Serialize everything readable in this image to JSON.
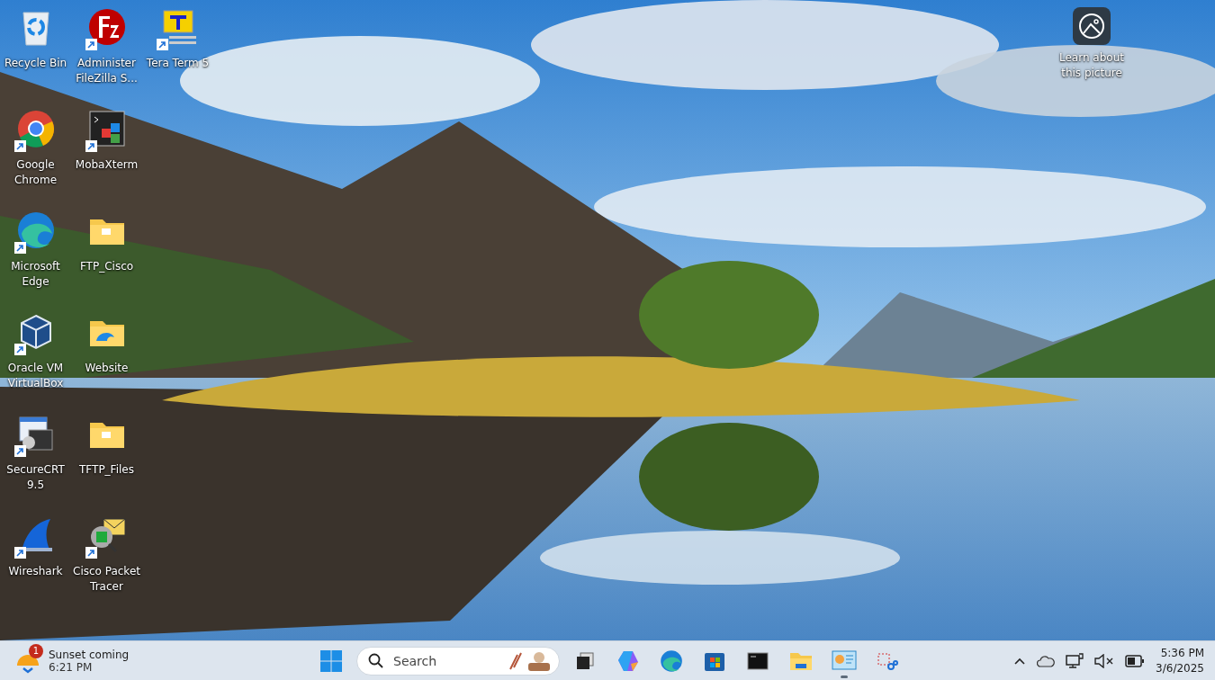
{
  "desktop_icons": [
    {
      "label": "Recycle Bin",
      "kind": "recycle-bin",
      "shortcut": false
    },
    {
      "label": "Google Chrome",
      "kind": "chrome",
      "shortcut": true
    },
    {
      "label": "Microsoft Edge",
      "kind": "edge",
      "shortcut": true
    },
    {
      "label": "Oracle VM VirtualBox",
      "kind": "virtualbox",
      "shortcut": true
    },
    {
      "label": "SecureCRT 9.5",
      "kind": "securecrt",
      "shortcut": true
    },
    {
      "label": "Wireshark",
      "kind": "wireshark",
      "shortcut": true
    },
    {
      "label": "Administer FileZilla S...",
      "kind": "filezilla",
      "shortcut": true
    },
    {
      "label": "MobaXterm",
      "kind": "mobaxterm",
      "shortcut": true
    },
    {
      "label": "FTP_Cisco",
      "kind": "folder",
      "shortcut": false
    },
    {
      "label": "Website",
      "kind": "folder-web",
      "shortcut": false
    },
    {
      "label": "TFTP_Files",
      "kind": "folder",
      "shortcut": false
    },
    {
      "label": "Cisco Packet Tracer",
      "kind": "packet-tracer",
      "shortcut": true
    },
    {
      "label": "Tera Term 5",
      "kind": "teraterm",
      "shortcut": true
    }
  ],
  "learn_more": {
    "label": "Learn about this picture"
  },
  "taskbar": {
    "widget": {
      "badge": "1",
      "title": "Sunset coming",
      "subtitle": "6:21 PM"
    },
    "search": {
      "placeholder": "Search"
    },
    "apps": [
      {
        "kind": "task-view",
        "running": false
      },
      {
        "kind": "copilot",
        "running": false
      },
      {
        "kind": "edge",
        "running": false
      },
      {
        "kind": "store",
        "running": false
      },
      {
        "kind": "terminal",
        "running": false
      },
      {
        "kind": "explorer",
        "running": false
      },
      {
        "kind": "dashboard",
        "running": true
      },
      {
        "kind": "snip",
        "running": false
      }
    ],
    "tray": {
      "muted": true,
      "time": "5:36 PM",
      "date": "3/6/2025"
    }
  }
}
